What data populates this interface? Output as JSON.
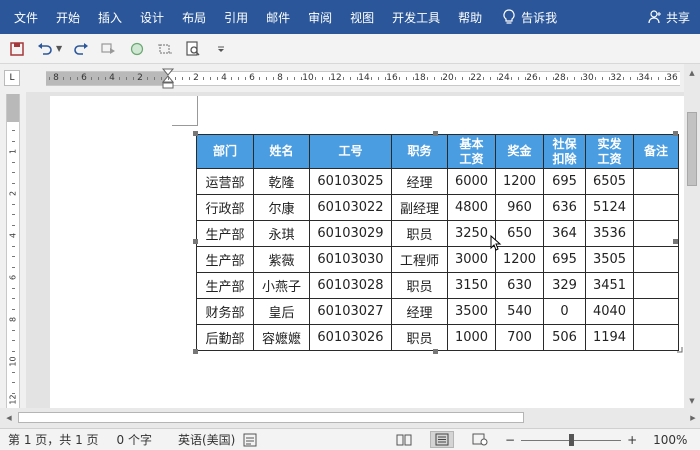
{
  "ribbon": {
    "tabs": [
      "文件",
      "开始",
      "插入",
      "设计",
      "布局",
      "引用",
      "邮件",
      "审阅",
      "视图",
      "开发工具",
      "帮助"
    ],
    "tell_me": "告诉我",
    "share": "共享"
  },
  "ruler": {
    "corner": "L",
    "horizontal_labels": [
      "8",
      "6",
      "4",
      "2",
      "2",
      "4",
      "6",
      "8",
      "10",
      "12",
      "14",
      "16",
      "18",
      "20",
      "22",
      "24",
      "26",
      "28",
      "30",
      "32",
      "34",
      "36"
    ],
    "vertical_labels": [
      "1",
      "2",
      "4",
      "6",
      "8",
      "10",
      "12"
    ]
  },
  "table": {
    "headers": [
      "部门",
      "姓名",
      "工号",
      "职务",
      "基本\n工资",
      "奖金",
      "社保\n扣除",
      "实发\n工资",
      "备注"
    ],
    "rows": [
      [
        "运营部",
        "乾隆",
        "60103025",
        "经理",
        "6000",
        "1200",
        "695",
        "6505",
        ""
      ],
      [
        "行政部",
        "尔康",
        "60103022",
        "副经理",
        "4800",
        "960",
        "636",
        "5124",
        ""
      ],
      [
        "生产部",
        "永琪",
        "60103029",
        "职员",
        "3250",
        "650",
        "364",
        "3536",
        ""
      ],
      [
        "生产部",
        "紫薇",
        "60103030",
        "工程师",
        "3000",
        "1200",
        "695",
        "3505",
        ""
      ],
      [
        "生产部",
        "小燕子",
        "60103028",
        "职员",
        "3150",
        "630",
        "329",
        "3451",
        ""
      ],
      [
        "财务部",
        "皇后",
        "60103027",
        "经理",
        "3500",
        "540",
        "0",
        "4040",
        ""
      ],
      [
        "后勤部",
        "容嬷嬷",
        "60103026",
        "职员",
        "1000",
        "700",
        "506",
        "1194",
        ""
      ]
    ],
    "header_color": "#4a9de0"
  },
  "status": {
    "page": "第 1 页，共 1 页",
    "words": "0 个字",
    "language": "英语(美国)",
    "zoom_minus": "−",
    "zoom_plus": "+",
    "zoom": "100%"
  },
  "colors": {
    "ribbon": "#2b579a"
  }
}
